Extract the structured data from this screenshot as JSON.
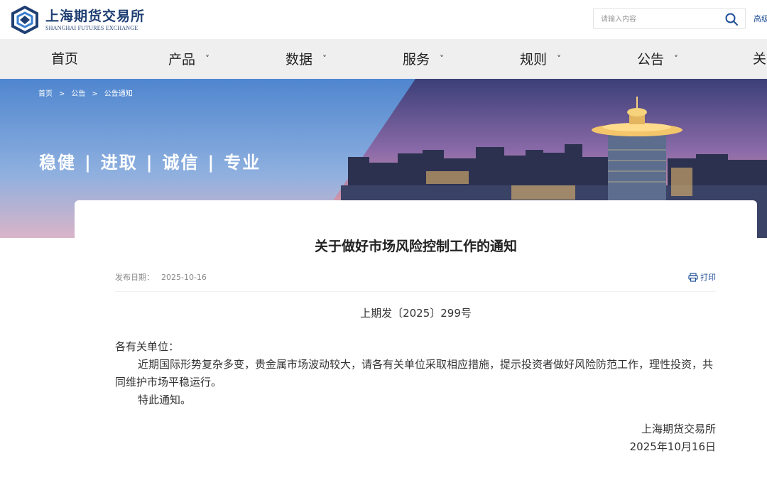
{
  "header": {
    "logo_cn": "上海期货交易所",
    "logo_en": "SHANGHAI FUTURES EXCHANGE",
    "search_placeholder": "请输入内容",
    "advanced_search": "高级",
    "search_icon": "search-icon"
  },
  "nav": {
    "items": [
      {
        "label": "首页"
      },
      {
        "label": "产品"
      },
      {
        "label": "数据"
      },
      {
        "label": "服务"
      },
      {
        "label": "规则"
      },
      {
        "label": "公告"
      },
      {
        "label": "关"
      }
    ],
    "caret": "˅"
  },
  "breadcrumb": [
    "首页",
    "公告",
    "公告通知"
  ],
  "breadcrumb_sep": ">",
  "slogan": [
    "稳健",
    "进取",
    "诚信",
    "专业"
  ],
  "slogan_sep": "|",
  "article": {
    "title": "关于做好市场风险控制工作的通知",
    "meta_label": "发布日期：",
    "meta_date": "2025-10-16",
    "print_label": "打印",
    "doc_number": "上期发〔2025〕299号",
    "greeting": "各有关单位：",
    "paragraph1": "近期国际形势复杂多变，贵金属市场波动较大，请各有关单位采取相应措施，提示投资者做好风险防范工作，理性投资，共同维护市场平稳运行。",
    "paragraph2": "特此通知。",
    "signer": "上海期货交易所",
    "sign_date": "2025年10月16日"
  },
  "colors": {
    "brand_blue": "#1f3f73",
    "link_blue": "#1f4f96",
    "nav_bg": "#efefef"
  }
}
